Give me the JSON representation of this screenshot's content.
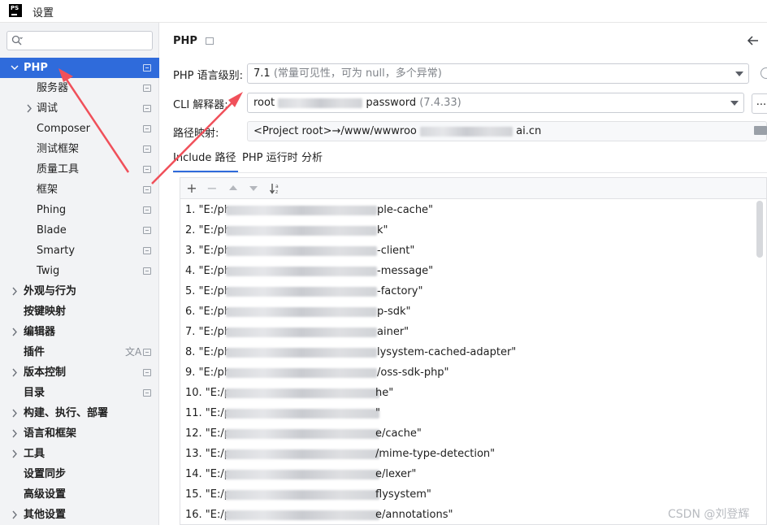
{
  "window": {
    "title": "设置",
    "logo_text": "PS"
  },
  "colors": {
    "accent": "#2f6bdb",
    "annotation_arrow": "#f0505a"
  },
  "sidebar": {
    "search": {
      "value": "",
      "placeholder": ""
    },
    "items": [
      {
        "label": "PHP",
        "level": 0,
        "chevron": "expanded",
        "selected": true,
        "bold": true,
        "project": true
      },
      {
        "label": "服务器",
        "level": 1,
        "chevron": "none",
        "project": true
      },
      {
        "label": "调试",
        "level": 1,
        "chevron": "collapsed",
        "project": true
      },
      {
        "label": "Composer",
        "level": 1,
        "chevron": "none",
        "project": true
      },
      {
        "label": "测试框架",
        "level": 1,
        "chevron": "none",
        "project": true
      },
      {
        "label": "质量工具",
        "level": 1,
        "chevron": "none",
        "project": true
      },
      {
        "label": "框架",
        "level": 1,
        "chevron": "none",
        "project": true
      },
      {
        "label": "Phing",
        "level": 1,
        "chevron": "none",
        "project": true
      },
      {
        "label": "Blade",
        "level": 1,
        "chevron": "none",
        "project": true
      },
      {
        "label": "Smarty",
        "level": 1,
        "chevron": "none",
        "project": true
      },
      {
        "label": "Twig",
        "level": 1,
        "chevron": "none",
        "project": true
      },
      {
        "label": "外观与行为",
        "level": 0,
        "chevron": "collapsed",
        "bold": true,
        "project": false
      },
      {
        "label": "按键映射",
        "level": 0,
        "chevron": "none",
        "bold": true,
        "project": false
      },
      {
        "label": "编辑器",
        "level": 0,
        "chevron": "collapsed",
        "bold": true,
        "project": false
      },
      {
        "label": "插件",
        "level": 0,
        "chevron": "none",
        "bold": true,
        "project": true,
        "translate_icon": true
      },
      {
        "label": "版本控制",
        "level": 0,
        "chevron": "collapsed",
        "bold": true,
        "project": true
      },
      {
        "label": "目录",
        "level": 0,
        "chevron": "none",
        "bold": true,
        "project": true
      },
      {
        "label": "构建、执行、部署",
        "level": 0,
        "chevron": "collapsed",
        "bold": true,
        "project": false
      },
      {
        "label": "语言和框架",
        "level": 0,
        "chevron": "collapsed",
        "bold": true,
        "project": false
      },
      {
        "label": "工具",
        "level": 0,
        "chevron": "collapsed",
        "bold": true,
        "project": false
      },
      {
        "label": "设置同步",
        "level": 0,
        "chevron": "none",
        "bold": true,
        "project": false
      },
      {
        "label": "高级设置",
        "level": 0,
        "chevron": "none",
        "bold": true,
        "project": false
      },
      {
        "label": "其他设置",
        "level": 0,
        "chevron": "collapsed",
        "bold": true,
        "project": false
      }
    ]
  },
  "main": {
    "title": "PHP",
    "language_level": {
      "label": "PHP 语言级别:",
      "value": "7.1",
      "hint": "(常量可见性，可为 null，多个异常)"
    },
    "cli_interpreter": {
      "label": "CLI 解释器:",
      "prefix": "root",
      "suffix": "password",
      "version": "(7.4.33)",
      "more_label": "..."
    },
    "path_mappings": {
      "label": "路径映射:",
      "prefix": "<Project root>→/www/wwwroo",
      "suffix": "ai.cn"
    },
    "tabs": [
      {
        "label": "Include 路径",
        "active": true
      },
      {
        "label": "PHP 运行时",
        "active": false
      },
      {
        "label": "分析",
        "active": false
      }
    ],
    "toolbar": {
      "add": "+",
      "remove": "−",
      "sort_icon": "sort-alpha-icon"
    },
    "include_paths": [
      {
        "prefix": "1. \"E:/ph",
        "suffix": "ple-cache\""
      },
      {
        "prefix": "2. \"E:/ph",
        "suffix": "k\""
      },
      {
        "prefix": "3. \"E:/ph",
        "suffix": "-client\""
      },
      {
        "prefix": "4. \"E:/ph",
        "suffix": "-message\""
      },
      {
        "prefix": "5. \"E:/ph",
        "suffix": "-factory\""
      },
      {
        "prefix": "6. \"E:/ph",
        "suffix": "p-sdk\""
      },
      {
        "prefix": "7. \"E:/ph",
        "suffix": "ainer\""
      },
      {
        "prefix": "8. \"E:/ph",
        "suffix": "lysystem-cached-adapter\""
      },
      {
        "prefix": "9. \"E:/ph",
        "suffix": "/oss-sdk-php\""
      },
      {
        "prefix": "10. \"E:/p",
        "suffix": "he\""
      },
      {
        "prefix": "11. \"E:/p",
        "suffix": "\""
      },
      {
        "prefix": "12. \"E:/p",
        "suffix": "e/cache\""
      },
      {
        "prefix": "13. \"E:/p",
        "suffix": "/mime-type-detection\""
      },
      {
        "prefix": "14. \"E:/p",
        "suffix": "e/lexer\""
      },
      {
        "prefix": "15. \"E:/p",
        "suffix": "flysystem\""
      },
      {
        "prefix": "16. \"E:/p",
        "suffix": "e/annotations\""
      }
    ]
  },
  "watermark": "CSDN @刘登辉"
}
